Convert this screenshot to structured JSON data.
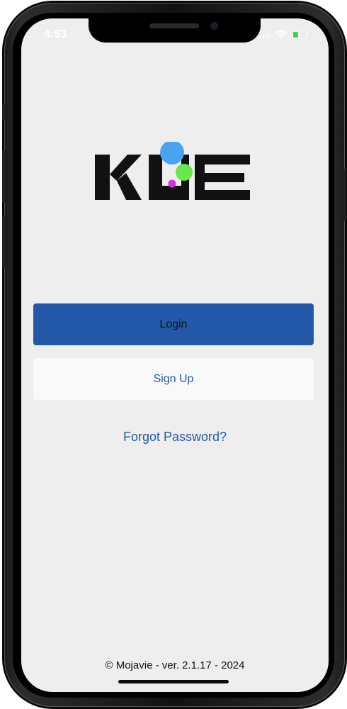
{
  "status_bar": {
    "time": "4:53",
    "icons": [
      "signal-icon",
      "wifi-icon",
      "battery-charging-icon"
    ]
  },
  "logo": {
    "text": "KUE",
    "colors": {
      "wordmark": "#111111",
      "dot_blue": "#4aa3f0",
      "dot_green": "#66e84a",
      "dot_magenta": "#d92fe0"
    }
  },
  "actions": {
    "login_label": "Login",
    "signup_label": "Sign Up",
    "forgot_label": "Forgot Password?"
  },
  "footer": {
    "text": "© Mojavie - ver. 2.1.17 - 2024"
  },
  "colors": {
    "accent": "#2459aa",
    "background": "#eeeeee",
    "secondary_button": "#f9f9f9"
  }
}
